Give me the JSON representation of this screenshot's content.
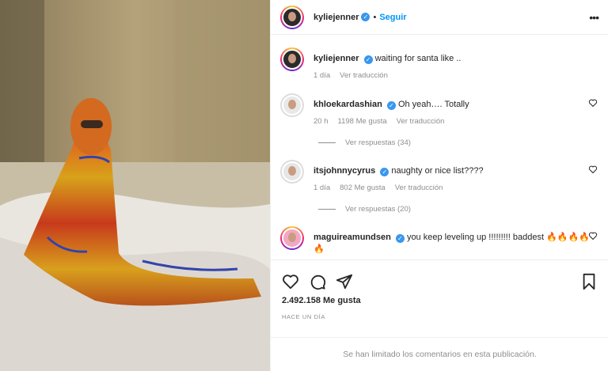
{
  "header": {
    "username": "kyliejenner",
    "separator": "•",
    "follow_label": "Seguir",
    "more_label": "•••"
  },
  "caption": {
    "username": "kyliejenner",
    "text": "waiting for santa like ..",
    "time": "1 día",
    "translate": "Ver traducción"
  },
  "comments": [
    {
      "username": "khloekardashian",
      "text": "Oh yeah…. Totally",
      "time": "20 h",
      "likes": "1198 Me gusta",
      "translate": "Ver traducción",
      "replies": "Ver respuestas (34)"
    },
    {
      "username": "itsjohnnycyrus",
      "text": "naughty or nice list????",
      "time": "1 día",
      "likes": "802 Me gusta",
      "translate": "Ver traducción",
      "replies": "Ver respuestas (20)"
    },
    {
      "username": "maguireamundsen",
      "text": "you keep leveling up !!!!!!!!! baddest 🔥🔥🔥🔥🔥"
    }
  ],
  "stats": {
    "likes": "2.492.158 Me gusta",
    "posted": "HACE UN DÍA"
  },
  "footer": {
    "limited": "Se han limitado los comentarios en esta publicación."
  },
  "icons": {
    "verified": "verified-badge-icon",
    "like": "heart-icon",
    "comment": "comment-icon",
    "share": "share-icon",
    "save": "bookmark-icon",
    "more": "more-options-icon"
  },
  "colors": {
    "link_blue": "#0095f6",
    "verified_blue": "#3897f0",
    "muted": "#8e8e8e",
    "text": "#262626"
  }
}
